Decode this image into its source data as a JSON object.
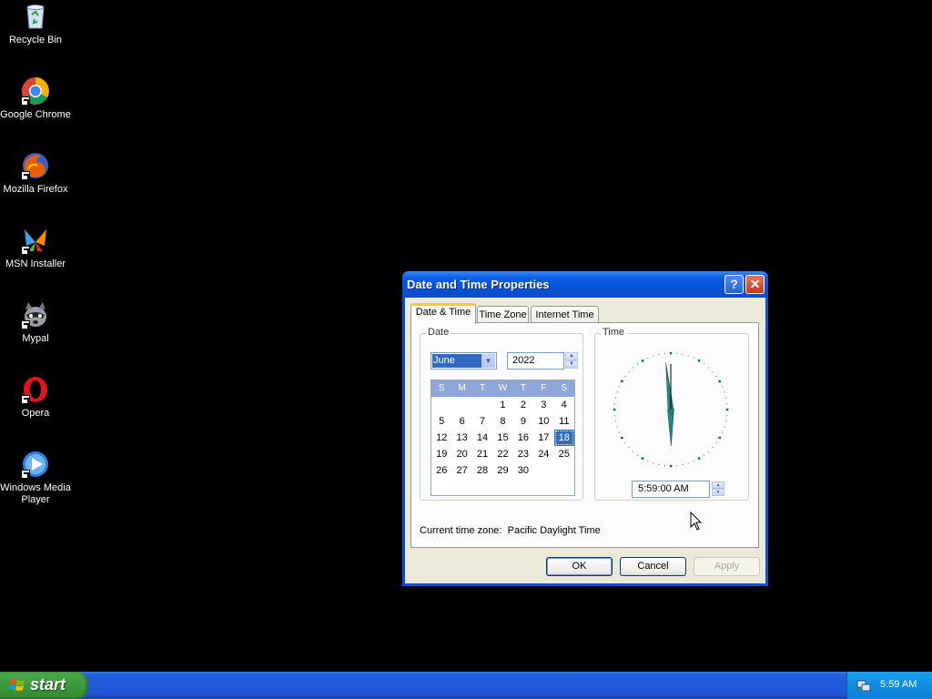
{
  "desktop": {
    "icons": [
      {
        "label": "Recycle Bin",
        "icon": "recycle-bin-icon"
      },
      {
        "label": "Google Chrome",
        "icon": "chrome-icon"
      },
      {
        "label": "Mozilla Firefox",
        "icon": "firefox-icon"
      },
      {
        "label": "MSN Installer",
        "icon": "msn-icon"
      },
      {
        "label": "Mypal",
        "icon": "mypal-icon"
      },
      {
        "label": "Opera",
        "icon": "opera-icon"
      },
      {
        "label": "Windows Media Player",
        "icon": "media-player-icon"
      }
    ]
  },
  "dialog": {
    "title": "Date and Time Properties",
    "help_glyph": "?",
    "close_glyph": "✕",
    "tabs": [
      {
        "label": "Date & Time",
        "active": true
      },
      {
        "label": "Time Zone",
        "active": false
      },
      {
        "label": "Internet Time",
        "active": false
      }
    ],
    "date_group_title": "Date",
    "time_group_title": "Time",
    "month": "June",
    "year": "2022",
    "weekdays": [
      "S",
      "M",
      "T",
      "W",
      "T",
      "F",
      "S"
    ],
    "weeks": [
      [
        "",
        "",
        "",
        "1",
        "2",
        "3",
        "4"
      ],
      [
        "5",
        "6",
        "7",
        "8",
        "9",
        "10",
        "11"
      ],
      [
        "12",
        "13",
        "14",
        "15",
        "16",
        "17",
        "18"
      ],
      [
        "19",
        "20",
        "21",
        "22",
        "23",
        "24",
        "25"
      ],
      [
        "26",
        "27",
        "28",
        "29",
        "30",
        "",
        ""
      ]
    ],
    "selected_day": "18",
    "time_value": "5:59:00 AM",
    "clock": {
      "hour": 5,
      "minute": 59,
      "second": 0
    },
    "timezone_label": "Current time zone:",
    "timezone_value": "Pacific Daylight Time",
    "ok_label": "OK",
    "cancel_label": "Cancel",
    "apply_label": "Apply"
  },
  "taskbar": {
    "start_label": "start",
    "clock": "5:59 AM"
  },
  "colors": {
    "desktop": "#000000",
    "titlebar": "#0a5ee6",
    "selection": "#316ac5",
    "clock_hands": "#1a8a82"
  }
}
